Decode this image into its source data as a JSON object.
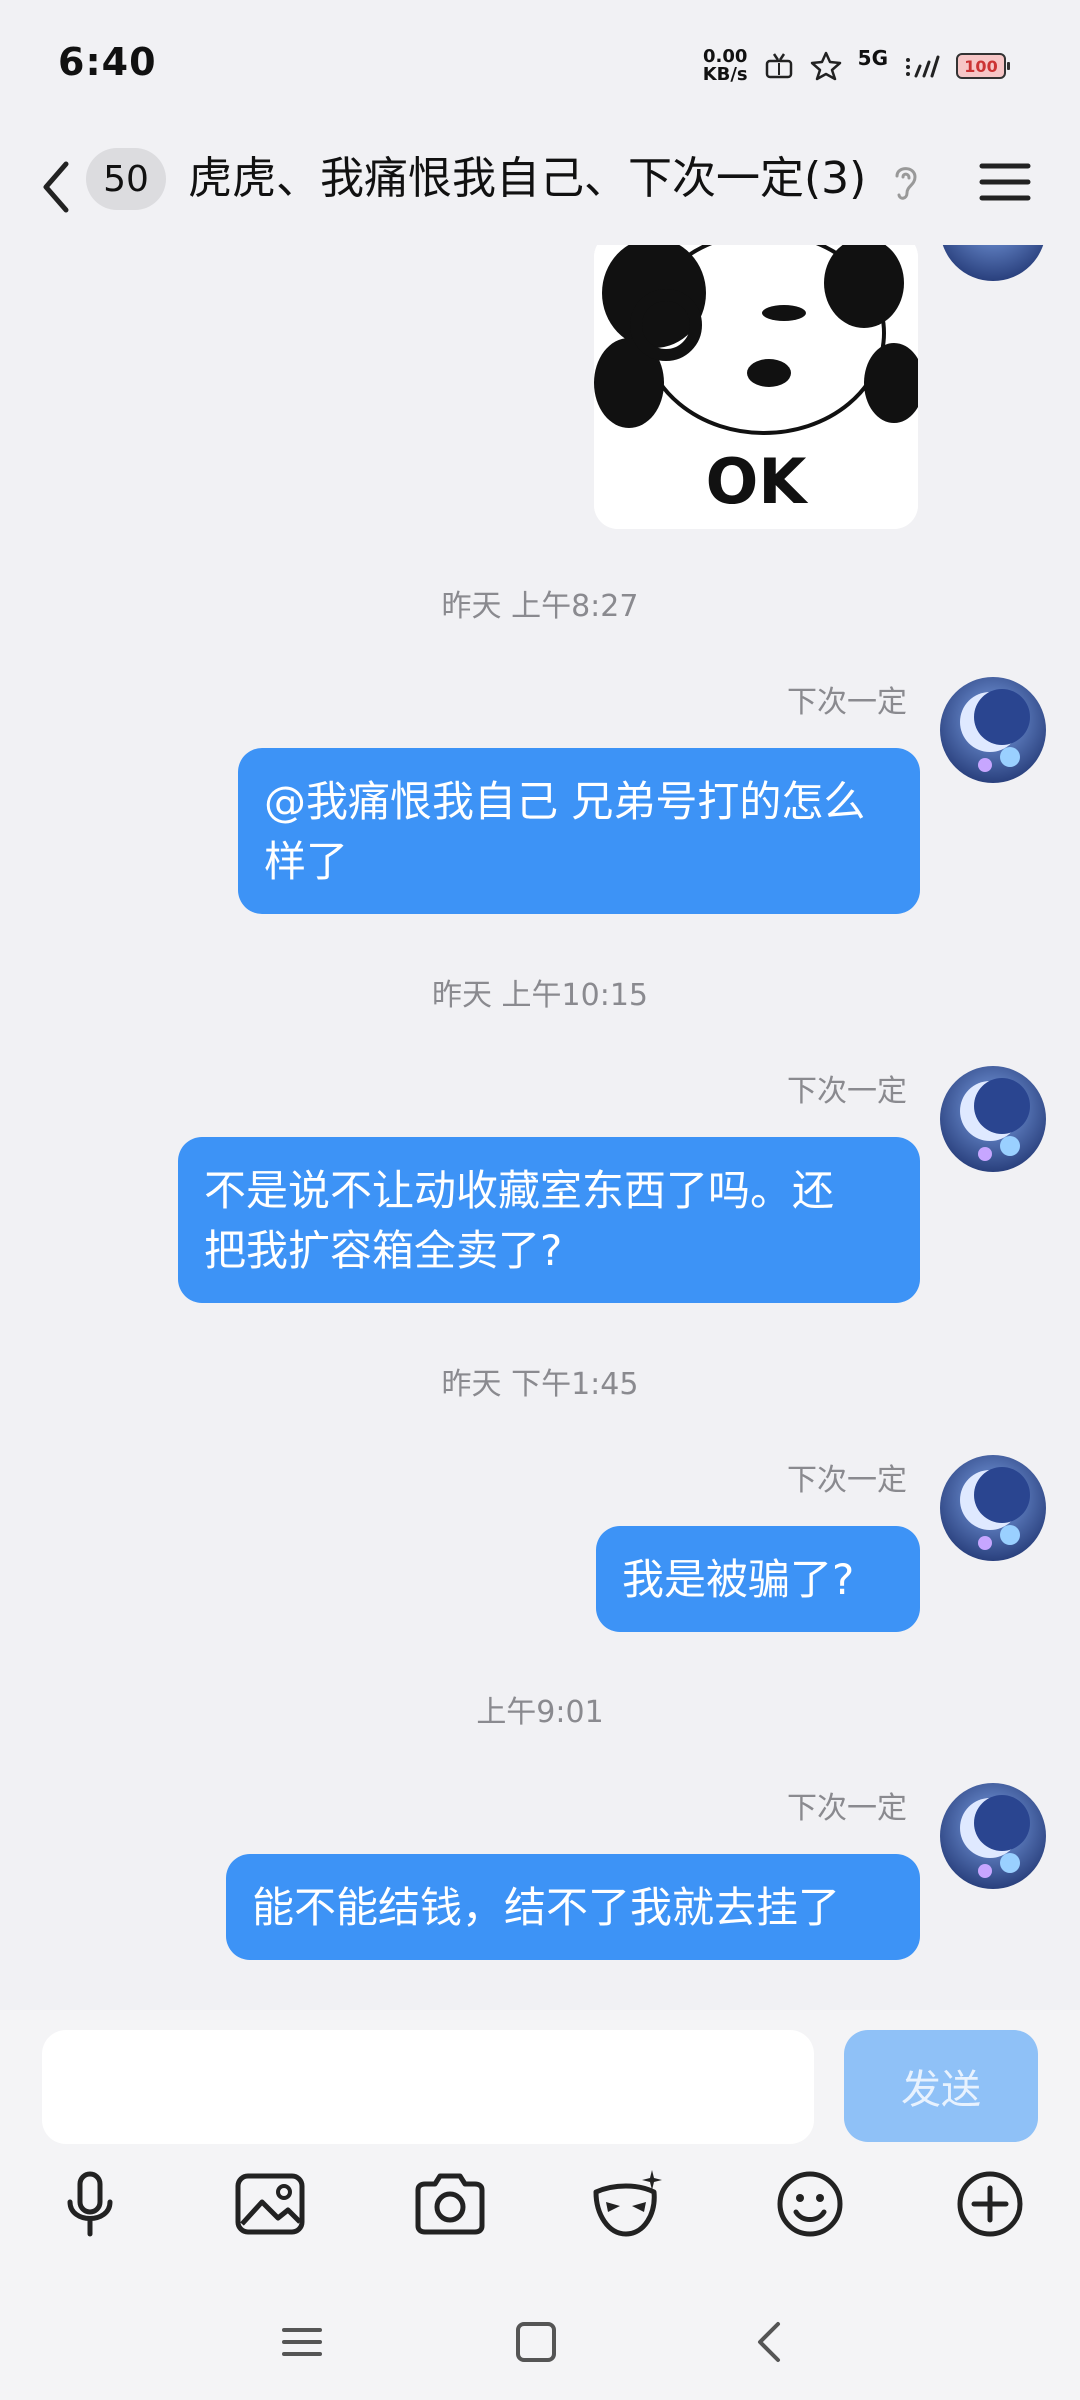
{
  "status_bar": {
    "time": "6:40",
    "net_speed_value": "0.00",
    "net_speed_unit": "KB/s",
    "network": "5G",
    "battery": "100"
  },
  "header": {
    "unread_count": "50",
    "title": "虎虎、我痛恨我自己、下次一定(3)"
  },
  "messages": [
    {
      "type": "sticker",
      "sticker_text": "OK"
    },
    {
      "type": "timestamp",
      "text": "昨天 上午8:27"
    },
    {
      "type": "message",
      "sender": "下次一定",
      "lines": [
        "@我痛恨我自己 兄弟号打的怎么",
        "样了"
      ]
    },
    {
      "type": "timestamp",
      "text": "昨天 上午10:15"
    },
    {
      "type": "message",
      "sender": "下次一定",
      "lines": [
        "不是说不让动收藏室东西了吗。还",
        "把我扩容箱全卖了?"
      ]
    },
    {
      "type": "timestamp",
      "text": "昨天 下午1:45"
    },
    {
      "type": "message",
      "sender": "下次一定",
      "lines": [
        "我是被骗了?"
      ]
    },
    {
      "type": "timestamp",
      "text": "上午9:01"
    },
    {
      "type": "message",
      "sender": "下次一定",
      "lines": [
        "能不能结钱，结不了我就去挂了"
      ]
    }
  ],
  "input": {
    "value": "",
    "send_label": "发送"
  },
  "toolbar_icons": [
    "microphone-icon",
    "image-icon",
    "camera-icon",
    "mask-icon",
    "emoji-icon",
    "plus-icon"
  ],
  "colors": {
    "background": "#f1f1f4",
    "bubble": "#3d93f6",
    "send_disabled": "#8fc1f7"
  }
}
